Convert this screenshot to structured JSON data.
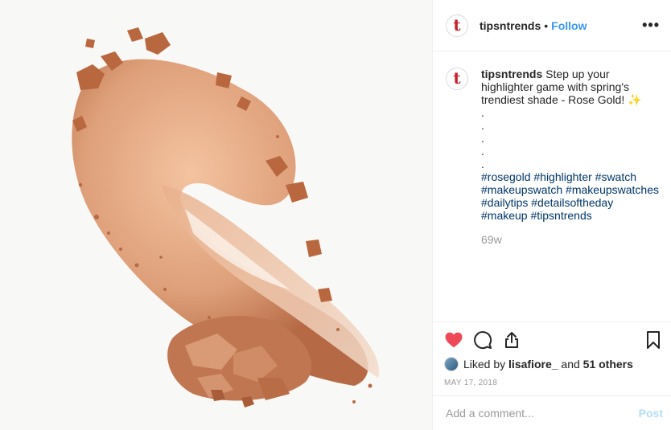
{
  "header": {
    "username": "tipsntrends",
    "separator": "•",
    "follow_label": "Follow",
    "more_label": "•••",
    "avatar_letter": "t"
  },
  "caption": {
    "username": "tipsntrends",
    "text": "Step up your highlighter game with spring's trendiest shade - Rose Gold! ✨",
    "dots": [
      ".",
      ".",
      ".",
      ".",
      "."
    ],
    "hashtags_lines": [
      "#rosegold #highlighter #swatch",
      "#makeupswatch #makeupswatches",
      "#dailytips #detailsoftheday",
      "#makeup #tipsntrends"
    ],
    "time": "69w"
  },
  "actions": {
    "like_icon": "heart-filled-icon",
    "comment_icon": "comment-icon",
    "share_icon": "share-icon",
    "save_icon": "bookmark-icon",
    "like_color": "#ed4956"
  },
  "likes": {
    "prefix": "Liked by",
    "user": "lisafiore_",
    "middle": "and",
    "others": "51 others"
  },
  "date": "MAY 17, 2018",
  "comment": {
    "placeholder": "Add a comment...",
    "post_label": "Post"
  },
  "colors": {
    "accent": "#3897f0",
    "hashtag": "#003569",
    "brand": "#c7202a"
  }
}
